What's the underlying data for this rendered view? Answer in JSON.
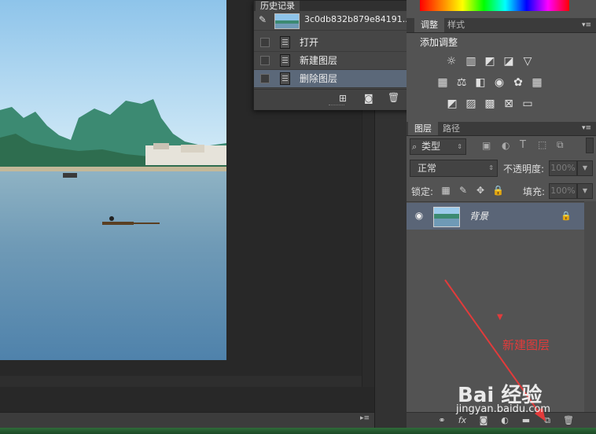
{
  "history": {
    "tab_label": "历史记录",
    "snapshot_label": "3c0db832b879e84191...",
    "items": [
      {
        "label": "打开"
      },
      {
        "label": "新建图层"
      },
      {
        "label": "删除图层"
      }
    ]
  },
  "adjustments": {
    "tab_label": "调整",
    "tab_styles": "样式",
    "title": "添加调整"
  },
  "layers": {
    "tab_label": "图层",
    "tab_paths": "路径",
    "filter_value": "类型",
    "blend_mode": "正常",
    "opacity_label": "不透明度:",
    "opacity_value": "100%",
    "lock_label": "锁定:",
    "fill_label": "填充:",
    "fill_value": "100%",
    "items": [
      {
        "name": "背景"
      }
    ]
  },
  "annotation": {
    "text": "新建图层",
    "color": "#e23b3b"
  },
  "watermark": {
    "logo": "Bai 经验",
    "url": "jingyan.baidu.com"
  },
  "colors": {
    "selected_row": "#5b6879",
    "panel_bg": "#535353",
    "annotation_red": "#e23b3b"
  }
}
